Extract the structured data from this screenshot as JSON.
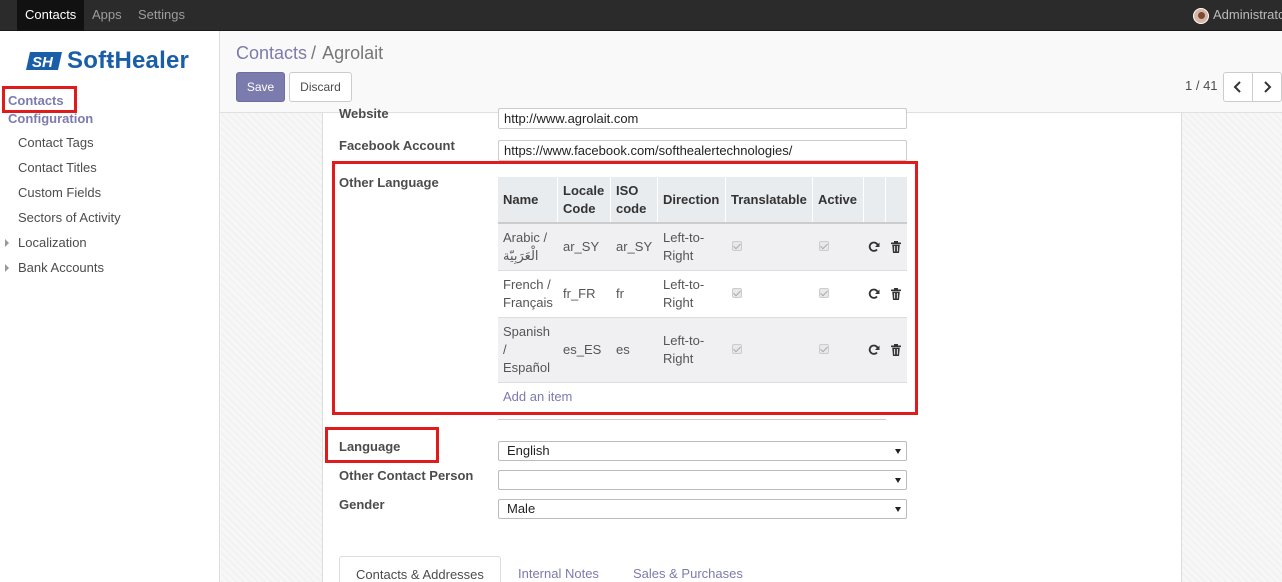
{
  "topbar": {
    "menus": [
      "Contacts",
      "Apps",
      "Settings"
    ],
    "user": "Administrator"
  },
  "sidebar": {
    "logo": "SofŧHealer",
    "section_contacts": "Contacts",
    "section_configuration": "Configuration",
    "items": [
      "Contact Tags",
      "Contact Titles",
      "Custom Fields",
      "Sectors of Activity",
      "Localization",
      "Bank Accounts"
    ]
  },
  "breadcrumb": {
    "parent": "Contacts",
    "separator": "/",
    "current": "Agrolait"
  },
  "buttons": {
    "save": "Save",
    "discard": "Discard"
  },
  "pager": {
    "value": "1 / 41"
  },
  "form": {
    "website_label": "Website",
    "website_value": "http://www.agrolait.com",
    "facebook_label": "Facebook Account",
    "facebook_value": "https://www.facebook.com/softhealertechnologies/",
    "other_language_label": "Other Language",
    "language_label": "Language",
    "language_value": "English",
    "other_contact_label": "Other Contact Person",
    "other_contact_value": "",
    "gender_label": "Gender",
    "gender_value": "Male"
  },
  "languages_table": {
    "headers": [
      "Name",
      "Locale Code",
      "ISO code",
      "Direction",
      "Translatable",
      "Active"
    ],
    "rows": [
      {
        "name": "Arabic / الْعَرَبِيّة",
        "locale": "ar_SY",
        "iso": "ar_SY",
        "direction": "Left-to-Right",
        "translatable": true,
        "active": true
      },
      {
        "name": "French / Français",
        "locale": "fr_FR",
        "iso": "fr",
        "direction": "Left-to-Right",
        "translatable": true,
        "active": true
      },
      {
        "name": "Spanish / Español",
        "locale": "es_ES",
        "iso": "es",
        "direction": "Left-to-Right",
        "translatable": true,
        "active": true
      }
    ],
    "add_item": "Add an item"
  },
  "tabs": [
    "Contacts & Addresses",
    "Internal Notes",
    "Sales & Purchases"
  ],
  "colors": {
    "accent": "#7c7bad",
    "highlight": "#e01b1b",
    "navbar": "#2b2b2b"
  }
}
